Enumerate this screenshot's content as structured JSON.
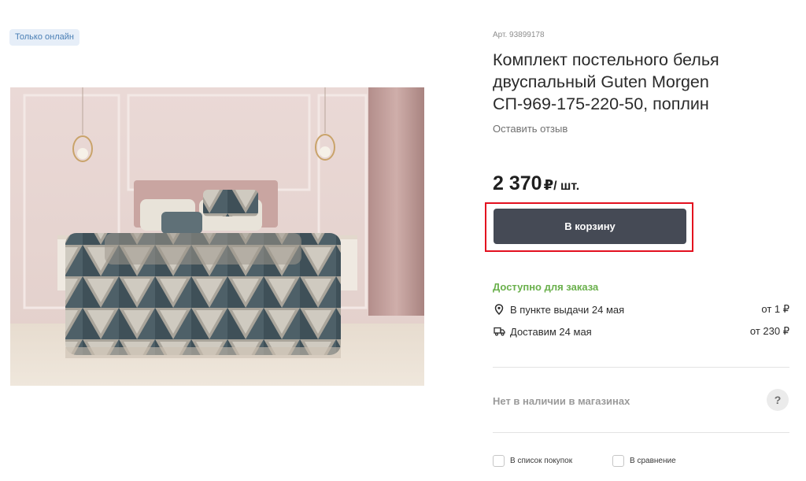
{
  "badge": {
    "label": "Только онлайн",
    "bg": "#e6eef8",
    "color": "#4a7fb5"
  },
  "product": {
    "sku": "Арт. 93899178",
    "title": "Комплект постельного белья двуспальный Guten Morgen СП-969-175-220-50, поплин",
    "review_link": "Оставить отзыв",
    "image_icon": "bedroom-photo"
  },
  "price": {
    "amount": "2 370",
    "currency": "₽",
    "unit": "/ шт."
  },
  "cart": {
    "label": "В корзину",
    "bg": "#454a55",
    "highlight": "#e3101f"
  },
  "availability": {
    "status": "Доступно для заказа",
    "status_color": "#6ab04c",
    "options": [
      {
        "icon": "location-pin-icon",
        "label": "В пункте выдачи 24 мая",
        "price": "от 1 ₽"
      },
      {
        "icon": "truck-icon",
        "label": "Доставим 24 мая",
        "price": "от 230 ₽"
      }
    ]
  },
  "stores": {
    "label": "Нет в наличии в магазинах",
    "help": "?"
  },
  "actions": {
    "shopping_list": "В список покупок",
    "compare": "В сравнение"
  }
}
